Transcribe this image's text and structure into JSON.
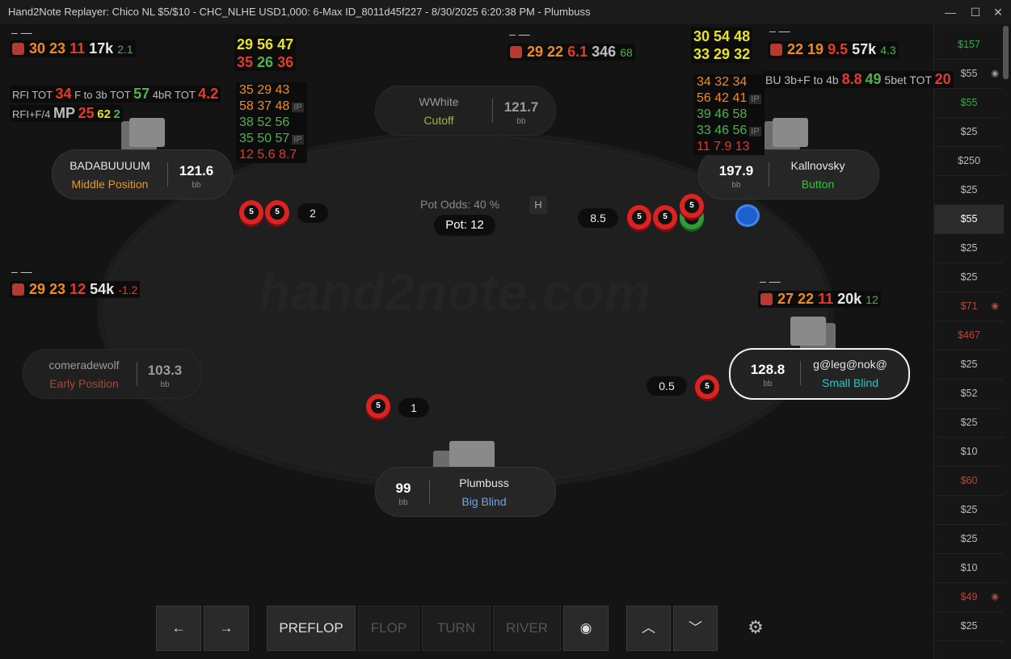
{
  "window": {
    "title": "Hand2Note Replayer: Chico NL $5/$10 - CHC_NLHE USD1,000: 6-Max ID_8011d45f227 - 8/30/2025 6:20:38 PM - Plumbuss",
    "minimize": "—",
    "maximize": "☐",
    "close": "✕"
  },
  "watermark": "hand2note.com",
  "history": [
    {
      "label": "$157",
      "style": "green",
      "eye": false
    },
    {
      "label": "$55",
      "style": "",
      "eye": true
    },
    {
      "label": "$55",
      "style": "green",
      "eye": false
    },
    {
      "label": "$25",
      "style": "",
      "eye": false
    },
    {
      "label": "$250",
      "style": "",
      "eye": false
    },
    {
      "label": "$25",
      "style": "",
      "eye": false
    },
    {
      "label": "$55",
      "style": "sel",
      "eye": false
    },
    {
      "label": "$25",
      "style": "",
      "eye": false
    },
    {
      "label": "$25",
      "style": "",
      "eye": false
    },
    {
      "label": "$71",
      "style": "red",
      "eye": true
    },
    {
      "label": "$467",
      "style": "red",
      "eye": false
    },
    {
      "label": "$25",
      "style": "",
      "eye": false
    },
    {
      "label": "$52",
      "style": "",
      "eye": false
    },
    {
      "label": "$25",
      "style": "",
      "eye": false
    },
    {
      "label": "$10",
      "style": "",
      "eye": false
    },
    {
      "label": "$60",
      "style": "red",
      "eye": false
    },
    {
      "label": "$25",
      "style": "",
      "eye": false
    },
    {
      "label": "$25",
      "style": "",
      "eye": false
    },
    {
      "label": "$10",
      "style": "",
      "eye": false
    },
    {
      "label": "$49",
      "style": "red",
      "eye": true
    },
    {
      "label": "$25",
      "style": "",
      "eye": false
    }
  ],
  "seats": {
    "mp": {
      "name": "BADABUUUUM",
      "position": "Middle Position",
      "stack": "121.6",
      "unit": "bb"
    },
    "co": {
      "name": "WWhite",
      "position": "Cutoff",
      "stack": "121.7",
      "unit": "bb"
    },
    "bu": {
      "name": "Kallnovsky",
      "position": "Button",
      "stack": "197.9",
      "unit": "bb"
    },
    "ep": {
      "name": "comeradewolf",
      "position": "Early Position",
      "stack": "103.3",
      "unit": "bb"
    },
    "sb": {
      "name": "g@leg@nok@",
      "position": "Small Blind",
      "stack": "128.8",
      "unit": "bb"
    },
    "bb": {
      "name": "Plumbuss",
      "position": "Big Blind",
      "stack": "99",
      "unit": "bb"
    }
  },
  "hud": {
    "mp": {
      "a": "30",
      "b": "23",
      "c": "11",
      "d": "17k",
      "e": "2.1"
    },
    "co": {
      "a": "29",
      "b": "22",
      "c": "6.1",
      "d": "346",
      "e": "68"
    },
    "bu": {
      "a": "22",
      "b": "19",
      "c": "9.5",
      "d": "57k",
      "e": "4.3"
    },
    "ep": {
      "a": "29",
      "b": "23",
      "c": "12",
      "d": "54k",
      "e": "-1.2"
    },
    "sb": {
      "a": "27",
      "b": "22",
      "c": "11",
      "d": "20k",
      "e": "12"
    },
    "dash": "–  —",
    "mp_stats_top": {
      "r1": [
        "29",
        "56",
        "47"
      ],
      "r2": [
        "35",
        "26",
        "36"
      ]
    },
    "mp_grid": [
      [
        "35",
        "29",
        "43",
        ""
      ],
      [
        "58",
        "37",
        "48",
        "IP"
      ],
      [
        "38",
        "52",
        "56",
        ""
      ],
      [
        "35",
        "50",
        "57",
        "IP"
      ],
      [
        "12",
        "5.6",
        "8.7",
        ""
      ]
    ],
    "bu_stats_top": {
      "r1": [
        "30",
        "54",
        "48"
      ],
      "r2": [
        "33",
        "29",
        "32"
      ]
    },
    "bu_grid": [
      [
        "34",
        "32",
        "34",
        ""
      ],
      [
        "56",
        "42",
        "41",
        "IP"
      ],
      [
        "39",
        "46",
        "58",
        ""
      ],
      [
        "33",
        "46",
        "56",
        "IP"
      ],
      [
        "11",
        "7.9",
        "13",
        ""
      ]
    ],
    "mp_extra1": {
      "l1": "RFI TOT",
      "v1": "34",
      "l2": "F to 3b TOT",
      "v2": "57",
      "l3": "4bR TOT",
      "v3": "4.2"
    },
    "mp_extra2": {
      "l1": "RFI+F/4",
      "l2": "MP",
      "v2": "25",
      "v3": "62",
      "v4": "2"
    },
    "bu_extra": {
      "l1": "BU 3b+F to 4b",
      "v1": "8.8",
      "v2": "49",
      "l2": "5bet TOT",
      "v3": "20"
    }
  },
  "bets": {
    "mp": "2",
    "bu": "8.5",
    "sb": "0.5",
    "bb": "1",
    "chip": "5"
  },
  "pot": {
    "odds": "Pot Odds: 40 %",
    "label": "Pot: 12",
    "icon": "H"
  },
  "controls": {
    "prev": "←",
    "next": "→",
    "preflop": "PREFLOP",
    "flop": "FLOP",
    "turn": "TURN",
    "river": "RIVER",
    "eye": "◉",
    "up": "︿",
    "down": "﹀",
    "gear": "⚙"
  },
  "colors": {
    "active_player": "#f2f2f2",
    "small_blind": "#29c7c7",
    "big_blind": "#6ea7e6",
    "button": "#39c23a",
    "mp": "#e29a2c",
    "co": "#a9b53a",
    "ep": "#a8473a"
  }
}
